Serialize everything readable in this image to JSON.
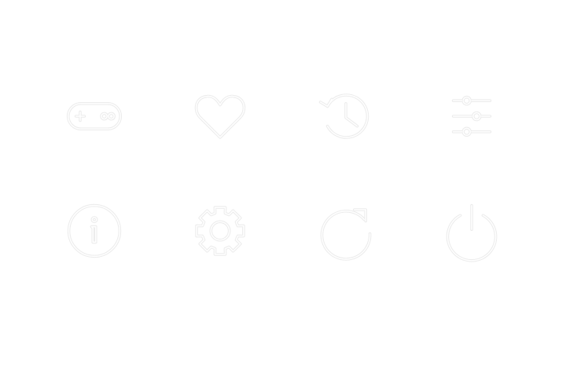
{
  "colors": {
    "icon_outline": "#ececec",
    "icon_fill": "#ffffff",
    "background": "#ffffff"
  },
  "icons": [
    {
      "name": "gamepad-icon"
    },
    {
      "name": "heart-icon"
    },
    {
      "name": "history-icon"
    },
    {
      "name": "sliders-icon"
    },
    {
      "name": "info-icon"
    },
    {
      "name": "gear-icon"
    },
    {
      "name": "refresh-icon"
    },
    {
      "name": "power-icon"
    }
  ]
}
